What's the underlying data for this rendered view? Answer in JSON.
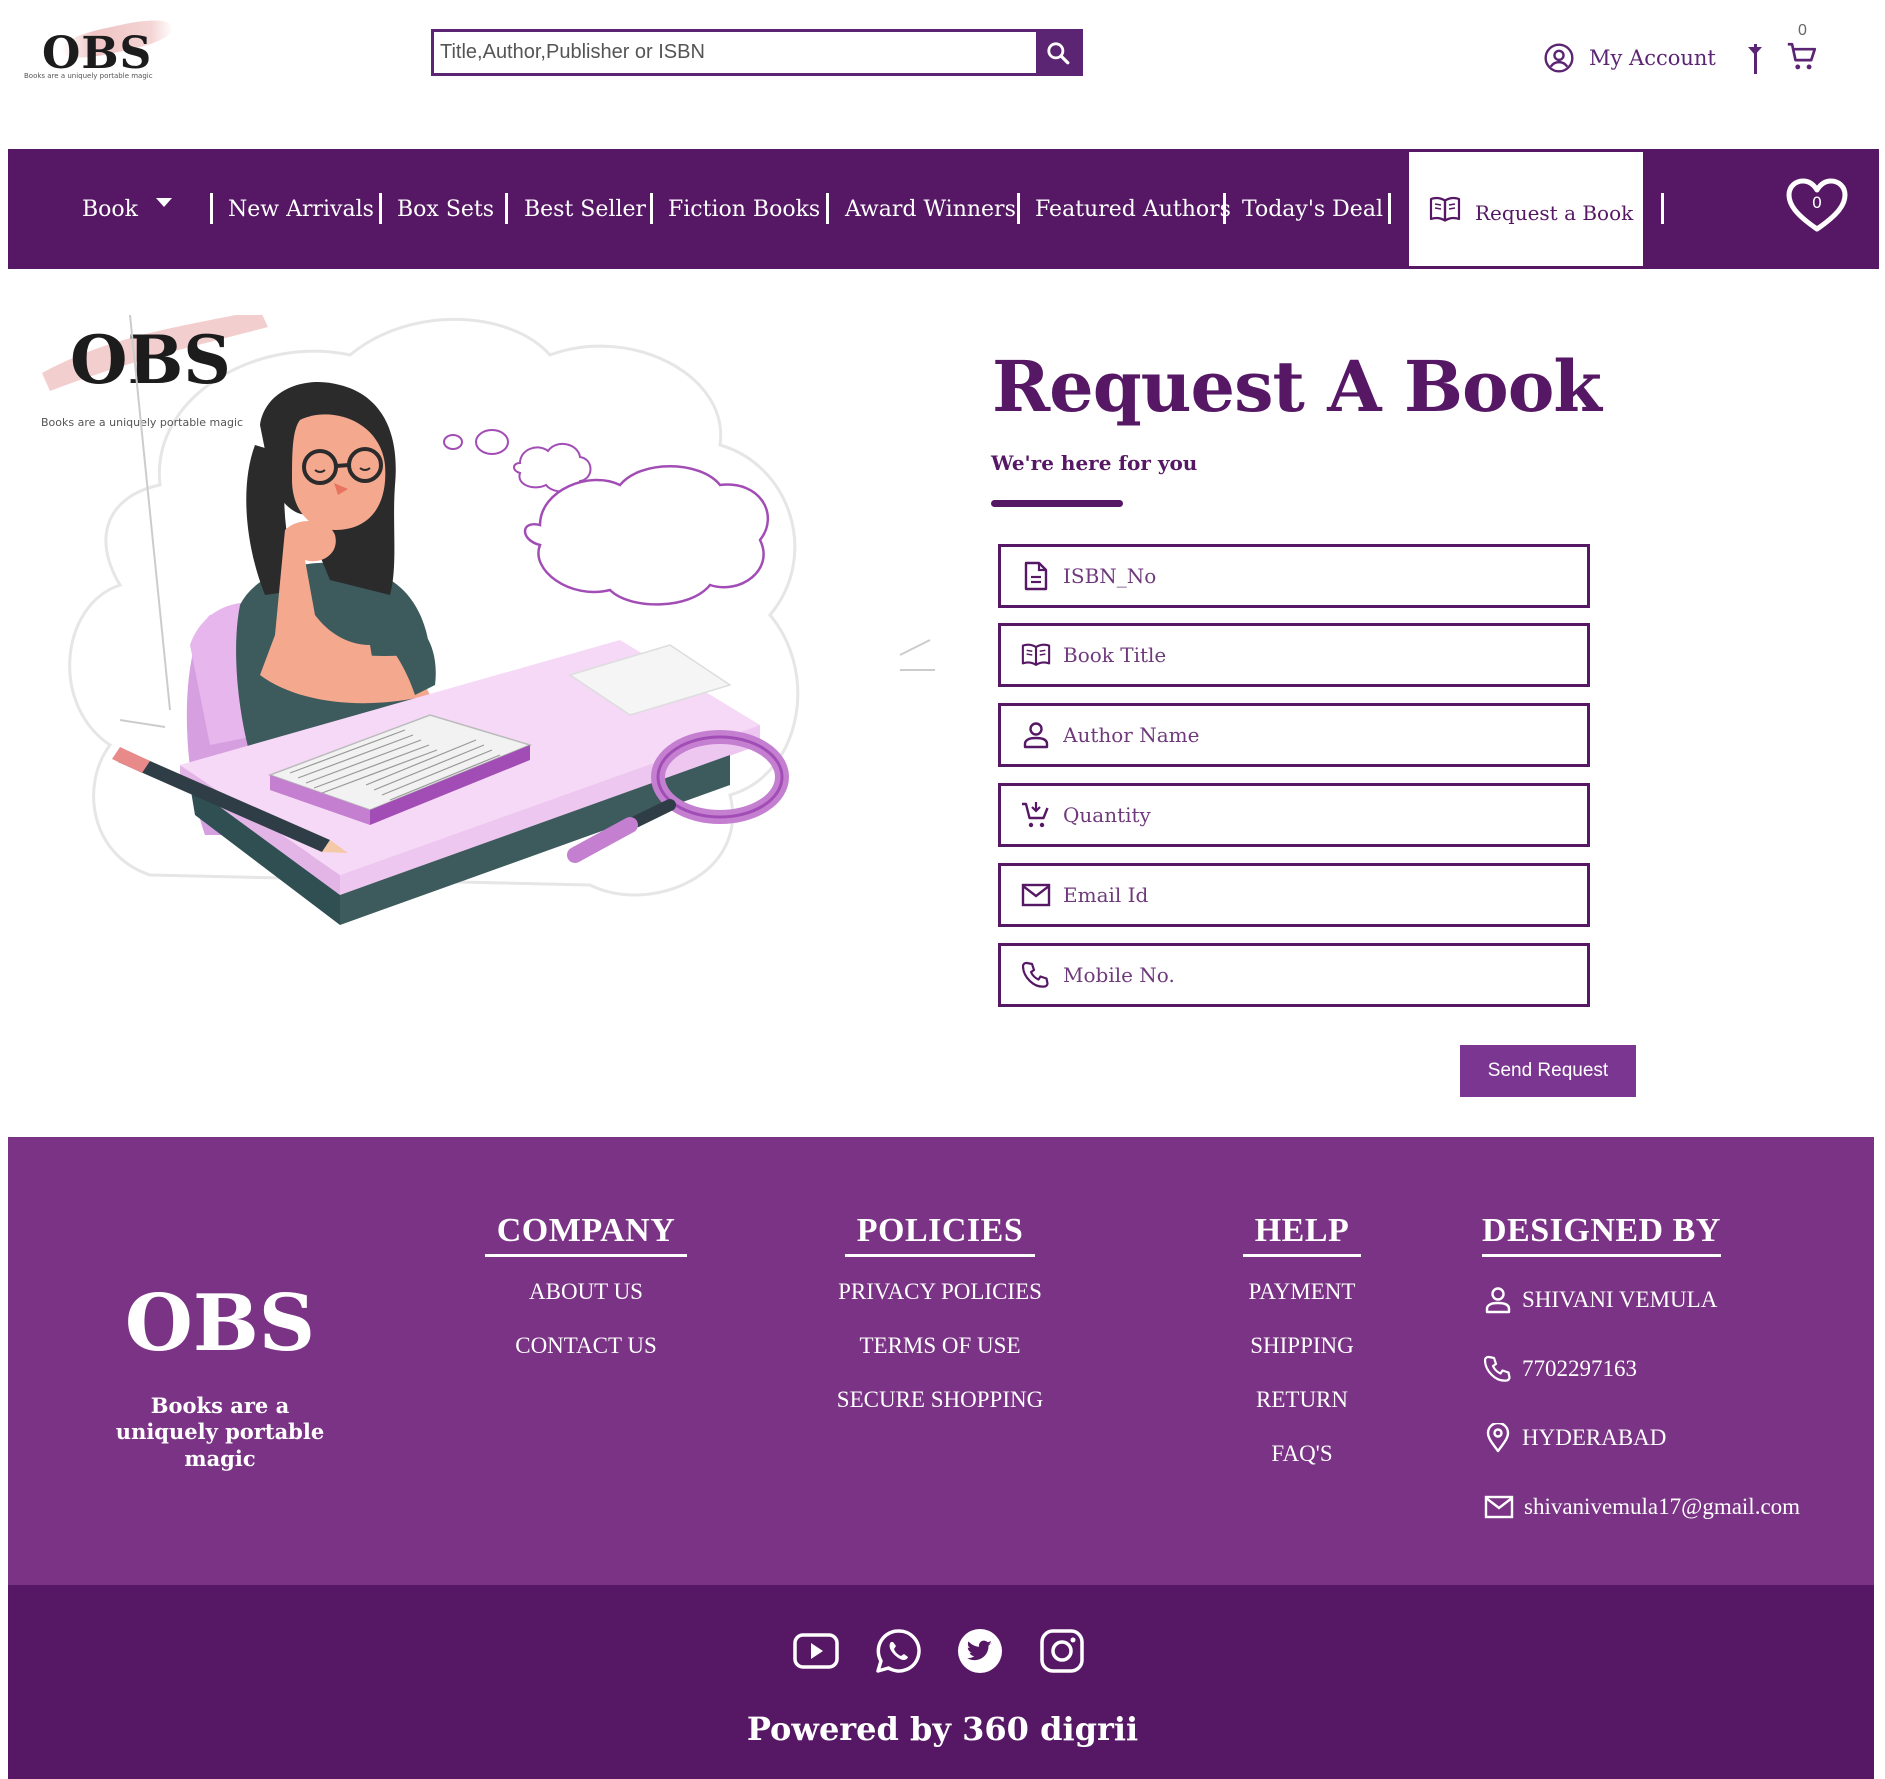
{
  "header": {
    "logo_word": "OBS",
    "logo_tagline": "Books are a uniquely portable magic",
    "search_placeholder": "Title,Author,Publisher or ISBN",
    "account_label": "My Account",
    "cart_count": "0"
  },
  "nav": {
    "items": [
      {
        "label": "Book"
      },
      {
        "label": "New Arrivals"
      },
      {
        "label": "Box Sets"
      },
      {
        "label": "Best Seller"
      },
      {
        "label": "Fiction Books"
      },
      {
        "label": "Award Winners"
      },
      {
        "label": "Featured Authors"
      },
      {
        "label": "Today's Deal"
      }
    ],
    "request_label": "Request a Book",
    "wishlist_count": "0"
  },
  "illustration": {
    "logo_word": "OBS",
    "logo_tagline": "Books are a uniquely portable magic"
  },
  "form": {
    "title": "Request A Book",
    "subtitle": "We're here for you",
    "fields": [
      {
        "icon": "document-icon",
        "placeholder": "ISBN_No"
      },
      {
        "icon": "open-book-icon",
        "placeholder": "Book Title"
      },
      {
        "icon": "person-icon",
        "placeholder": "Author Name"
      },
      {
        "icon": "cart-icon",
        "placeholder": "Quantity"
      },
      {
        "icon": "mail-icon",
        "placeholder": "Email Id"
      },
      {
        "icon": "phone-icon",
        "placeholder": "Mobile No."
      }
    ],
    "submit_label": "Send Request"
  },
  "footer": {
    "logo_word": "OBS",
    "tagline": "Books are a uniquely portable magic",
    "company": {
      "title": "COMPANY",
      "links": [
        "ABOUT US",
        "CONTACT US"
      ]
    },
    "policies": {
      "title": "POLICIES",
      "links": [
        "PRIVACY POLICIES",
        "TERMS OF USE",
        "SECURE SHOPPING"
      ]
    },
    "help": {
      "title": "HELP",
      "links": [
        "PAYMENT",
        "SHIPPING",
        "RETURN",
        "FAQ'S"
      ]
    },
    "designed_by": {
      "title": "DESIGNED BY",
      "name": "SHIVANI VEMULA",
      "phone": "7702297163",
      "city": "HYDERABAD",
      "email": "shivanivemula17@gmail.com"
    },
    "socials": [
      "youtube-icon",
      "whatsapp-icon",
      "twitter-icon",
      "instagram-icon"
    ],
    "powered_by": "Powered by 360 digrii"
  },
  "colors": {
    "primary": "#561865",
    "footer": "#7b3386",
    "button": "#7b3691",
    "illustration_pink": "#e7b6ec"
  }
}
